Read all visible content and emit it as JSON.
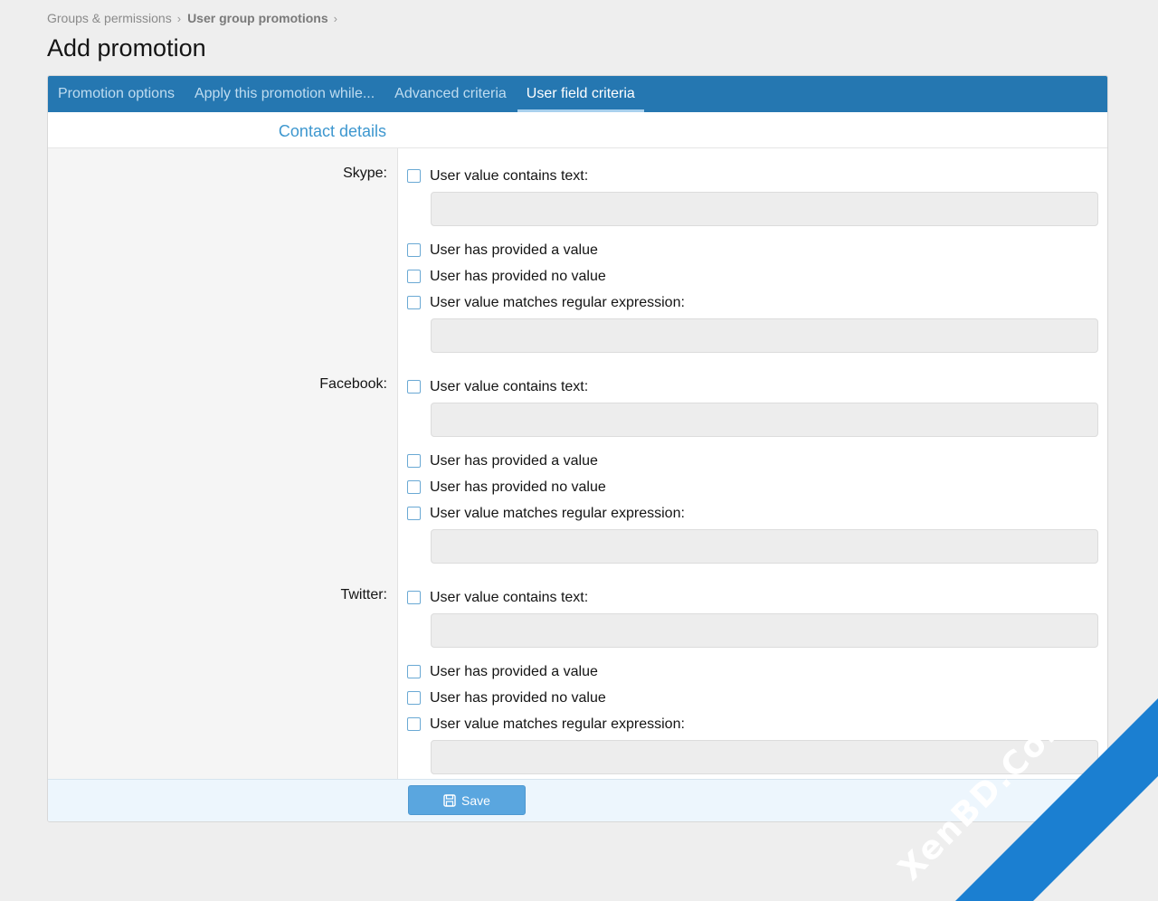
{
  "breadcrumb": {
    "items": [
      {
        "label": "Groups & permissions"
      },
      {
        "label": "User group promotions"
      }
    ]
  },
  "page": {
    "title": "Add promotion"
  },
  "tabs": [
    {
      "label": "Promotion options",
      "active": false
    },
    {
      "label": "Apply this promotion while...",
      "active": false
    },
    {
      "label": "Advanced criteria",
      "active": false
    },
    {
      "label": "User field criteria",
      "active": true
    }
  ],
  "section": {
    "title": "Contact details"
  },
  "fields": [
    {
      "label": "Skype:",
      "options": {
        "contains_text": "User value contains text:",
        "provided": "User has provided a value",
        "no_value": "User has provided no value",
        "regex": "User value matches regular expression:"
      },
      "contains_value": "",
      "regex_value": ""
    },
    {
      "label": "Facebook:",
      "options": {
        "contains_text": "User value contains text:",
        "provided": "User has provided a value",
        "no_value": "User has provided no value",
        "regex": "User value matches regular expression:"
      },
      "contains_value": "",
      "regex_value": ""
    },
    {
      "label": "Twitter:",
      "options": {
        "contains_text": "User value contains text:",
        "provided": "User has provided a value",
        "no_value": "User has provided no value",
        "regex": "User value matches regular expression:"
      },
      "contains_value": "",
      "regex_value": ""
    }
  ],
  "footer": {
    "save_label": "Save"
  },
  "watermark": {
    "text": "XenBD.Com"
  },
  "colors": {
    "tab_bar": "#2577b1",
    "accent": "#3d97cf",
    "button": "#5aa6df",
    "watermark": "#1b7fd1"
  }
}
